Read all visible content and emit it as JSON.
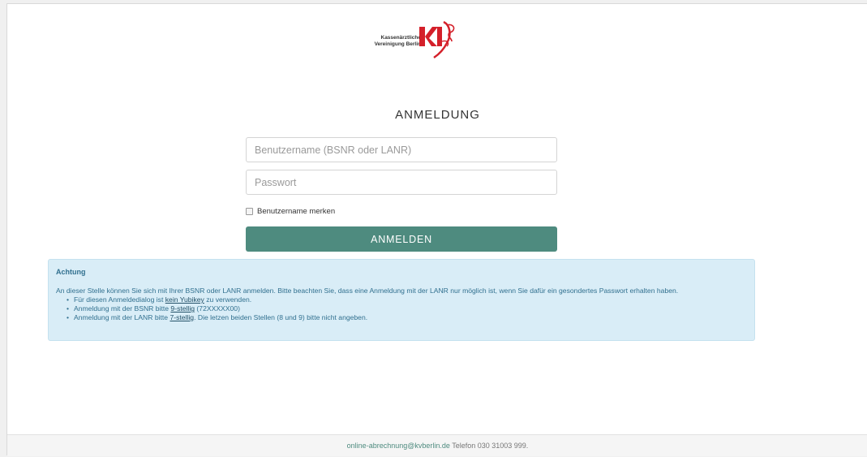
{
  "logo": {
    "line1": "Kassenärztliche",
    "line2": "Vereinigung Berlin",
    "mark": "KV"
  },
  "login": {
    "title": "ANMELDUNG",
    "username_placeholder": "Benutzername (BSNR oder LANR)",
    "username_value": "",
    "password_placeholder": "Passwort",
    "password_value": "",
    "remember_label": "Benutzername merken",
    "remember_checked": false,
    "submit_label": "ANMELDEN"
  },
  "notice": {
    "title": "Achtung",
    "intro": "An dieser Stelle können Sie sich mit Ihrer BSNR oder LANR anmelden. Bitte beachten Sie, dass eine Anmeldung mit der LANR nur möglich ist, wenn Sie dafür ein gesondertes Passwort erhalten haben.",
    "items": [
      {
        "before": "Für diesen Anmeldedialog ist ",
        "link": "kein Yubikey",
        "after": " zu verwenden."
      },
      {
        "before": "Anmeldung mit der BSNR bitte ",
        "link": "9-stellig",
        "after": " (72XXXXX00)"
      },
      {
        "before": "Anmeldung mit der LANR bitte ",
        "link": "7-stellig",
        "after": ". Die letzen beiden Stellen (8 und 9) bitte nicht angeben."
      }
    ]
  },
  "footer": {
    "email": "online-abrechnung@kvberlin.de",
    "phone_text": " Telefon 030 31003 999."
  },
  "colors": {
    "accent": "#4e8b7f",
    "notice_bg": "#d9edf7",
    "notice_text": "#31708f",
    "logo_red": "#d4202a"
  }
}
